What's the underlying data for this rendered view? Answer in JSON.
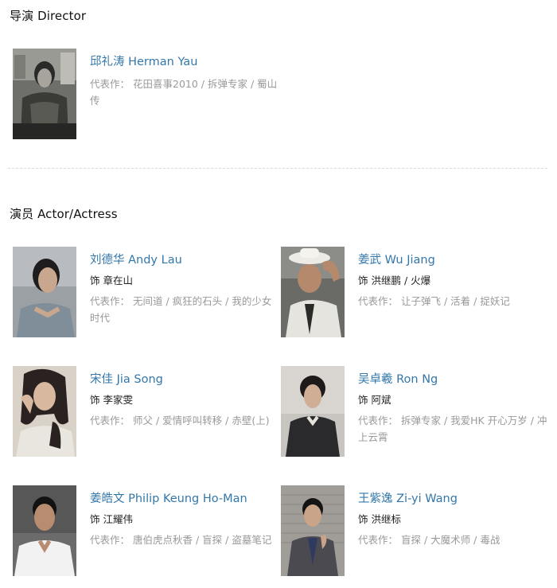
{
  "director_section": {
    "title": "导演 Director",
    "people": [
      {
        "name": "邱礼涛 Herman Yau",
        "works_label": "代表作：",
        "works": "花田喜事2010 / 拆弹专家 / 蜀山传",
        "photo_icon": "director-portrait"
      }
    ]
  },
  "cast_section": {
    "title": "演员 Actor/Actress",
    "people": [
      {
        "name": "刘德华 Andy Lau",
        "role": "饰 章在山",
        "works_label": "代表作：",
        "works": "无间道 / 疯狂的石头 / 我的少女时代"
      },
      {
        "name": "姜武 Wu Jiang",
        "role": "饰 洪继鹏 / 火爆",
        "works_label": "代表作：",
        "works": "让子弹飞 / 活着 / 捉妖记"
      },
      {
        "name": "宋佳 Jia Song",
        "role": "饰 李家雯",
        "works_label": "代表作：",
        "works": "师父 / 爱情呼叫转移 / 赤壁(上)"
      },
      {
        "name": "吴卓羲 Ron Ng",
        "role": "饰 阿斌",
        "works_label": "代表作：",
        "works": "拆弹专家 / 我爱HK 开心万岁 / 冲上云霄"
      },
      {
        "name": "姜皓文 Philip Keung Ho-Man",
        "role": "饰 江耀伟",
        "works_label": "代表作：",
        "works": "唐伯虎点秋香 / 盲探 / 盗墓笔记"
      },
      {
        "name": "王紫逸 Zi-yi Wang",
        "role": "饰 洪继标",
        "works_label": "代表作：",
        "works": "盲探 / 大魔术师 / 毒战"
      }
    ]
  },
  "colors": {
    "link": "#3377aa",
    "muted": "#999999",
    "divider": "#dcdcdc"
  }
}
